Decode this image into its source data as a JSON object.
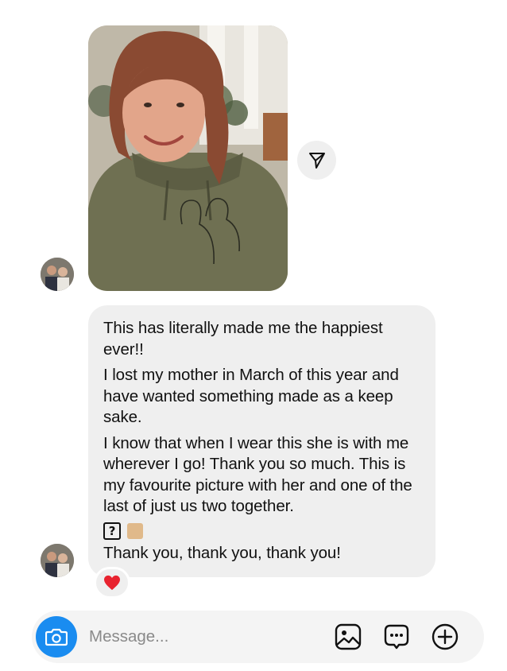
{
  "conversation": {
    "photo_message": {
      "media": "selfie-photo"
    },
    "text_message": {
      "paragraphs": [
        "This has literally made me the happiest ever!!",
        "I lost my mother in March of this year and have wanted something made as a keep sake.",
        "I know that when I wear this she is with me wherever I go! Thank you so much. This is my favourite picture with her and one of the last of just us two together."
      ],
      "emoji_glyphs": [
        "?"
      ],
      "closing": "Thank you, thank you, thank you!",
      "reaction": "heart-emoji"
    }
  },
  "composer": {
    "placeholder": "Message...",
    "icons": [
      "camera-icon",
      "gallery-icon",
      "sticker-icon",
      "plus-icon"
    ]
  },
  "colors": {
    "accent": "#1a8cf0",
    "bubble": "#efefef",
    "heart": "#e8232f",
    "placeholder": "#8a8a8a"
  }
}
